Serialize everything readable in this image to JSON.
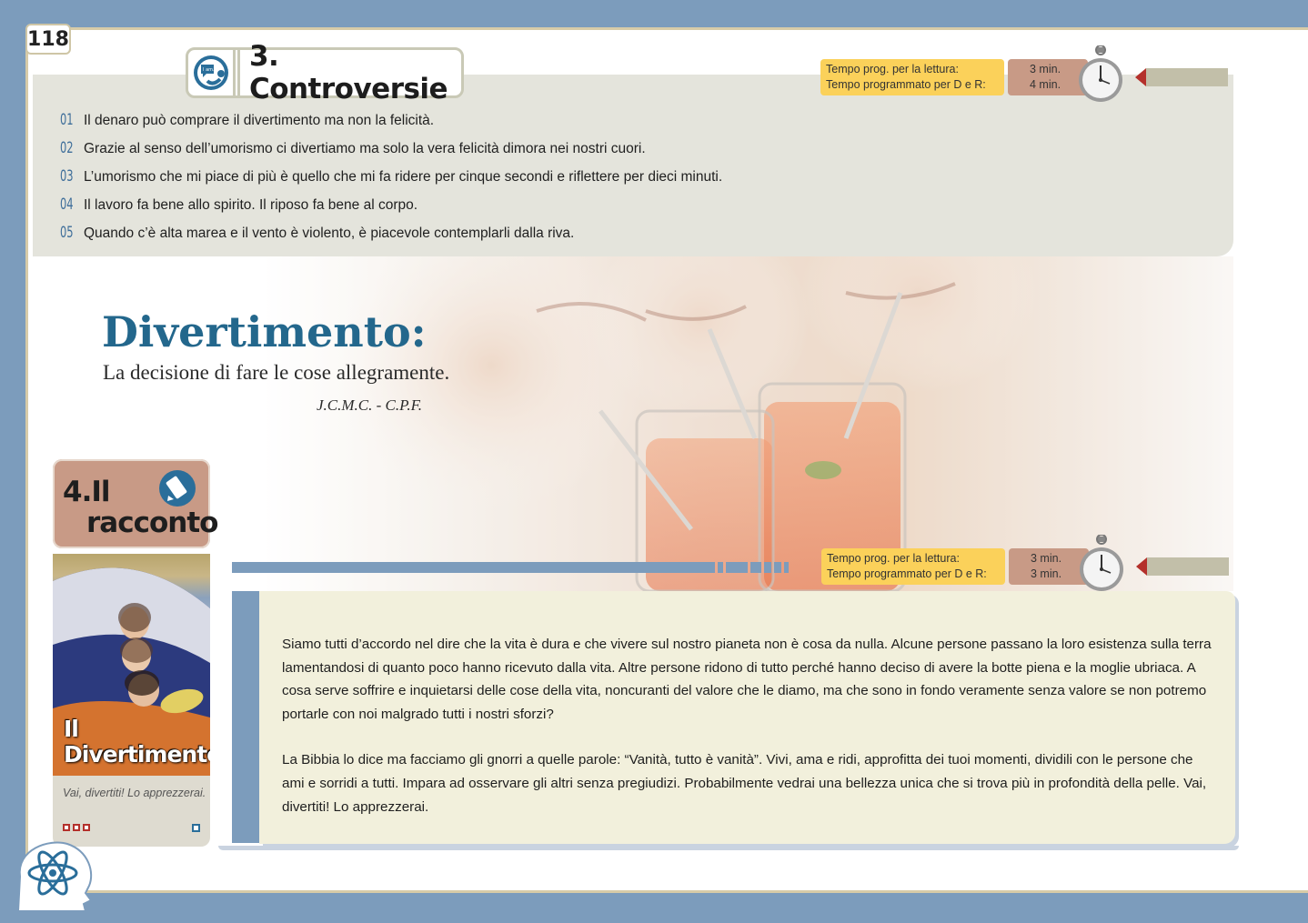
{
  "page_number": "118",
  "section": {
    "title": "3. Controversie",
    "icon": "i-am-speech-icon",
    "icon_text": "I am..."
  },
  "controversies": [
    {
      "num": "01",
      "text": "Il denaro può comprare il divertimento ma non la felicità."
    },
    {
      "num": "02",
      "text": "Grazie al senso dell’umorismo ci divertiamo ma solo la vera felicità dimora nei nostri cuori."
    },
    {
      "num": "03",
      "text": "L’umorismo che mi piace di più è quello che mi fa ridere per cinque secondi e riflettere per dieci minuti."
    },
    {
      "num": "04",
      "text": "Il lavoro fa bene allo spirito. Il riposo fa bene al corpo."
    },
    {
      "num": "05",
      "text": "Quando c’è alta marea e il vento è violento, è piacevole contemplarli dalla riva."
    }
  ],
  "timer_top": {
    "label_reading": "Tempo prog. per la lettura:",
    "label_dr": "Tempo programmato per D e R:",
    "value_reading": "3 min.",
    "value_dr": "4 min."
  },
  "quote": {
    "title": "Divertimento:",
    "subtitle": "La decisione di fare le cose allegramente.",
    "author": "J.C.M.C. - C.P.F."
  },
  "story_tag": {
    "line1": "4.Il",
    "line2": "racconto",
    "icon": "pencil-icon"
  },
  "card": {
    "title_line1": "Il",
    "title_line2": "Divertimento",
    "caption": "Vai, divertiti! Lo apprezzerai."
  },
  "timer_story": {
    "label_reading": "Tempo prog. per la lettura:",
    "label_dr": "Tempo programmato per D e R:",
    "value_reading": "3 min.",
    "value_dr": "3 min."
  },
  "story_paragraphs": [
    "Siamo tutti d’accordo nel dire che la vita è dura e che vivere sul nostro pianeta non è cosa da nulla. Alcune persone passano la loro esistenza sulla terra lamentandosi di quanto poco hanno ricevuto dalla vita. Altre persone ridono di tutto perché hanno deciso di avere la botte piena e la moglie ubriaca. A cosa serve soffrire e inquietarsi delle cose della vita, noncuranti del valore che le diamo, ma che sono in fondo veramente senza valore se non potremo portarle con noi malgrado tutti i nostri sforzi?",
    "La Bibbia lo dice ma facciamo gli gnorri a quelle parole: “Vanità, tutto è vanità”. Vivi, ama e ridi, approfitta dei tuoi momenti, dividili con le persone che ami e sorridi a tutti. Impara ad osservare gli altri senza pregiudizi. Probabilmente vedrai una bellezza unica che si trova più in profondità della pelle. Vai, divertiti! Lo apprezzerai."
  ],
  "colors": {
    "blue_frame": "#7c9cbc",
    "accent_blue": "#23678c",
    "timer_yellow": "#fbd15a",
    "timer_rose": "#c89a86",
    "arrow_red": "#b4302b"
  }
}
